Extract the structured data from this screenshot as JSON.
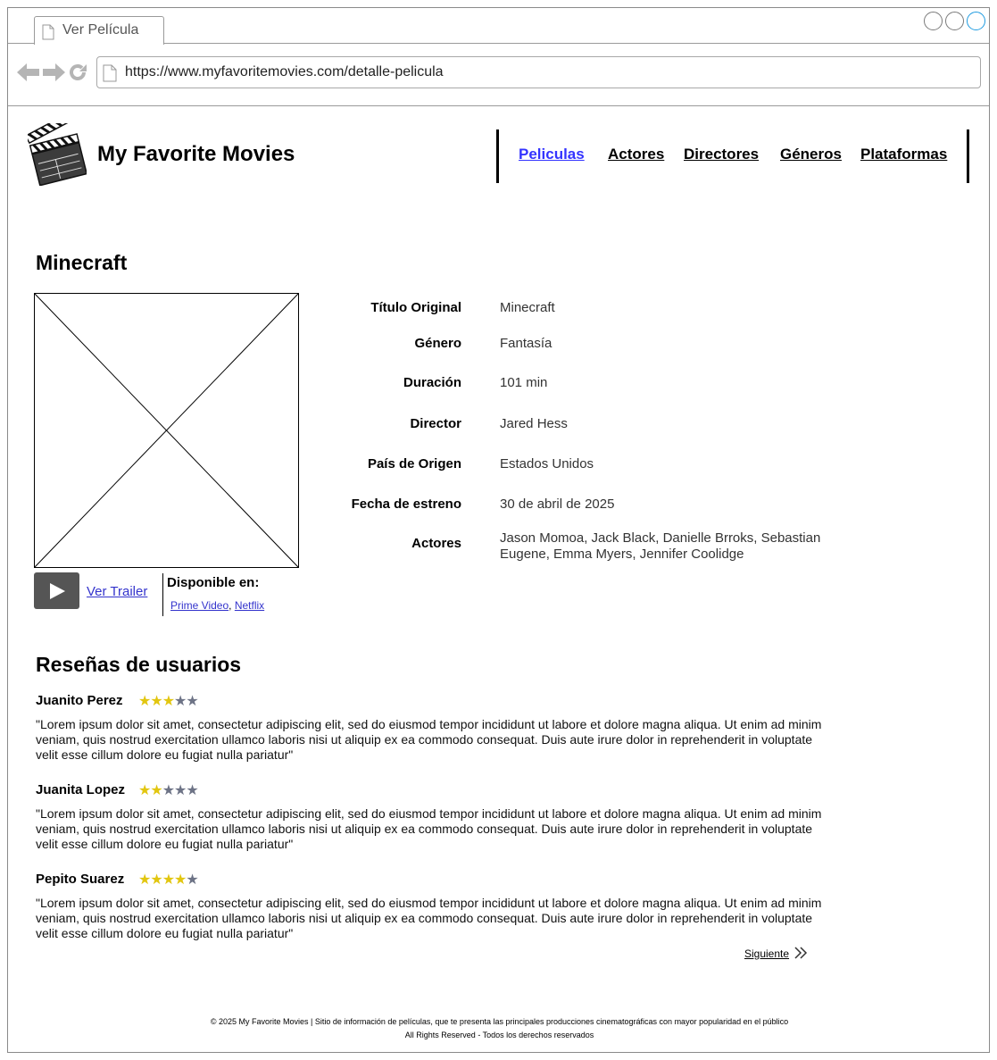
{
  "browser": {
    "tab_title": "Ver Película",
    "url": "https://www.myfavoritemovies.com/detalle-pelicula"
  },
  "site": {
    "brand": "My Favorite Movies",
    "nav": [
      "Peliculas",
      "Actores",
      "Directores",
      "Géneros",
      "Plataformas"
    ],
    "active_nav": "Peliculas"
  },
  "movie": {
    "title": "Minecraft",
    "details": [
      {
        "label": "Título Original",
        "value": "Minecraft"
      },
      {
        "label": "Género",
        "value": "Fantasía"
      },
      {
        "label": "Duración",
        "value": "101 min"
      },
      {
        "label": "Director",
        "value": "Jared Hess"
      },
      {
        "label": "País de Origen",
        "value": "Estados Unidos"
      },
      {
        "label": "Fecha de estreno",
        "value": "30 de abril de 2025"
      },
      {
        "label": "Actores",
        "value": "Jason Momoa, Jack Black, Danielle Brroks, Sebastian Eugene, Emma Myers, Jennifer Coolidge"
      }
    ],
    "trailer_label": "Ver Trailer",
    "available_label": "Disponible en:",
    "platforms": [
      "Prime Video",
      "Netflix"
    ],
    "platform_separator": ", "
  },
  "reviews": {
    "heading": "Reseñas de usuarios",
    "items": [
      {
        "name": "Juanito Perez",
        "rating": 3,
        "max": 5,
        "text": "\"Lorem ipsum dolor sit amet, consectetur adipiscing elit, sed do eiusmod tempor incididunt ut labore et dolore magna aliqua. Ut enim ad minim veniam, quis nostrud exercitation ullamco laboris nisi ut aliquip ex ea commodo consequat. Duis aute irure dolor in reprehenderit in voluptate velit esse cillum dolore eu fugiat nulla pariatur\""
      },
      {
        "name": "Juanita Lopez",
        "rating": 2,
        "max": 5,
        "text": "\"Lorem ipsum dolor sit amet, consectetur adipiscing elit, sed do eiusmod tempor incididunt ut labore et dolore magna aliqua. Ut enim ad minim veniam, quis nostrud exercitation ullamco laboris nisi ut aliquip ex ea commodo consequat. Duis aute irure dolor in reprehenderit in voluptate velit esse cillum dolore eu fugiat nulla pariatur\""
      },
      {
        "name": "Pepito Suarez",
        "rating": 4,
        "max": 5,
        "text": "\"Lorem ipsum dolor sit amet, consectetur adipiscing elit, sed do eiusmod tempor incididunt ut labore et dolore magna aliqua. Ut enim ad minim veniam, quis nostrud exercitation ullamco laboris nisi ut aliquip ex ea commodo consequat. Duis aute irure dolor in reprehenderit in voluptate velit esse cillum dolore eu fugiat nulla pariatur\""
      }
    ],
    "next_label": "Siguiente"
  },
  "footer": {
    "line1": "© 2025 My Favorite Movies | Sitio de información de películas, que te presenta las principales producciones cinematográficas con mayor popularidad en el público",
    "line2": "All Rights Reserved - Todos los derechos reservados"
  },
  "colors": {
    "link": "#3333cc",
    "active_nav": "#3333ff",
    "star_on": "#e2c610",
    "star_off": "#6d7386"
  },
  "icons": [
    "document-icon",
    "back-arrow-icon",
    "forward-arrow-icon",
    "reload-icon",
    "clapperboard-icon",
    "play-icon",
    "double-chevron-right-icon",
    "image-placeholder-icon"
  ]
}
